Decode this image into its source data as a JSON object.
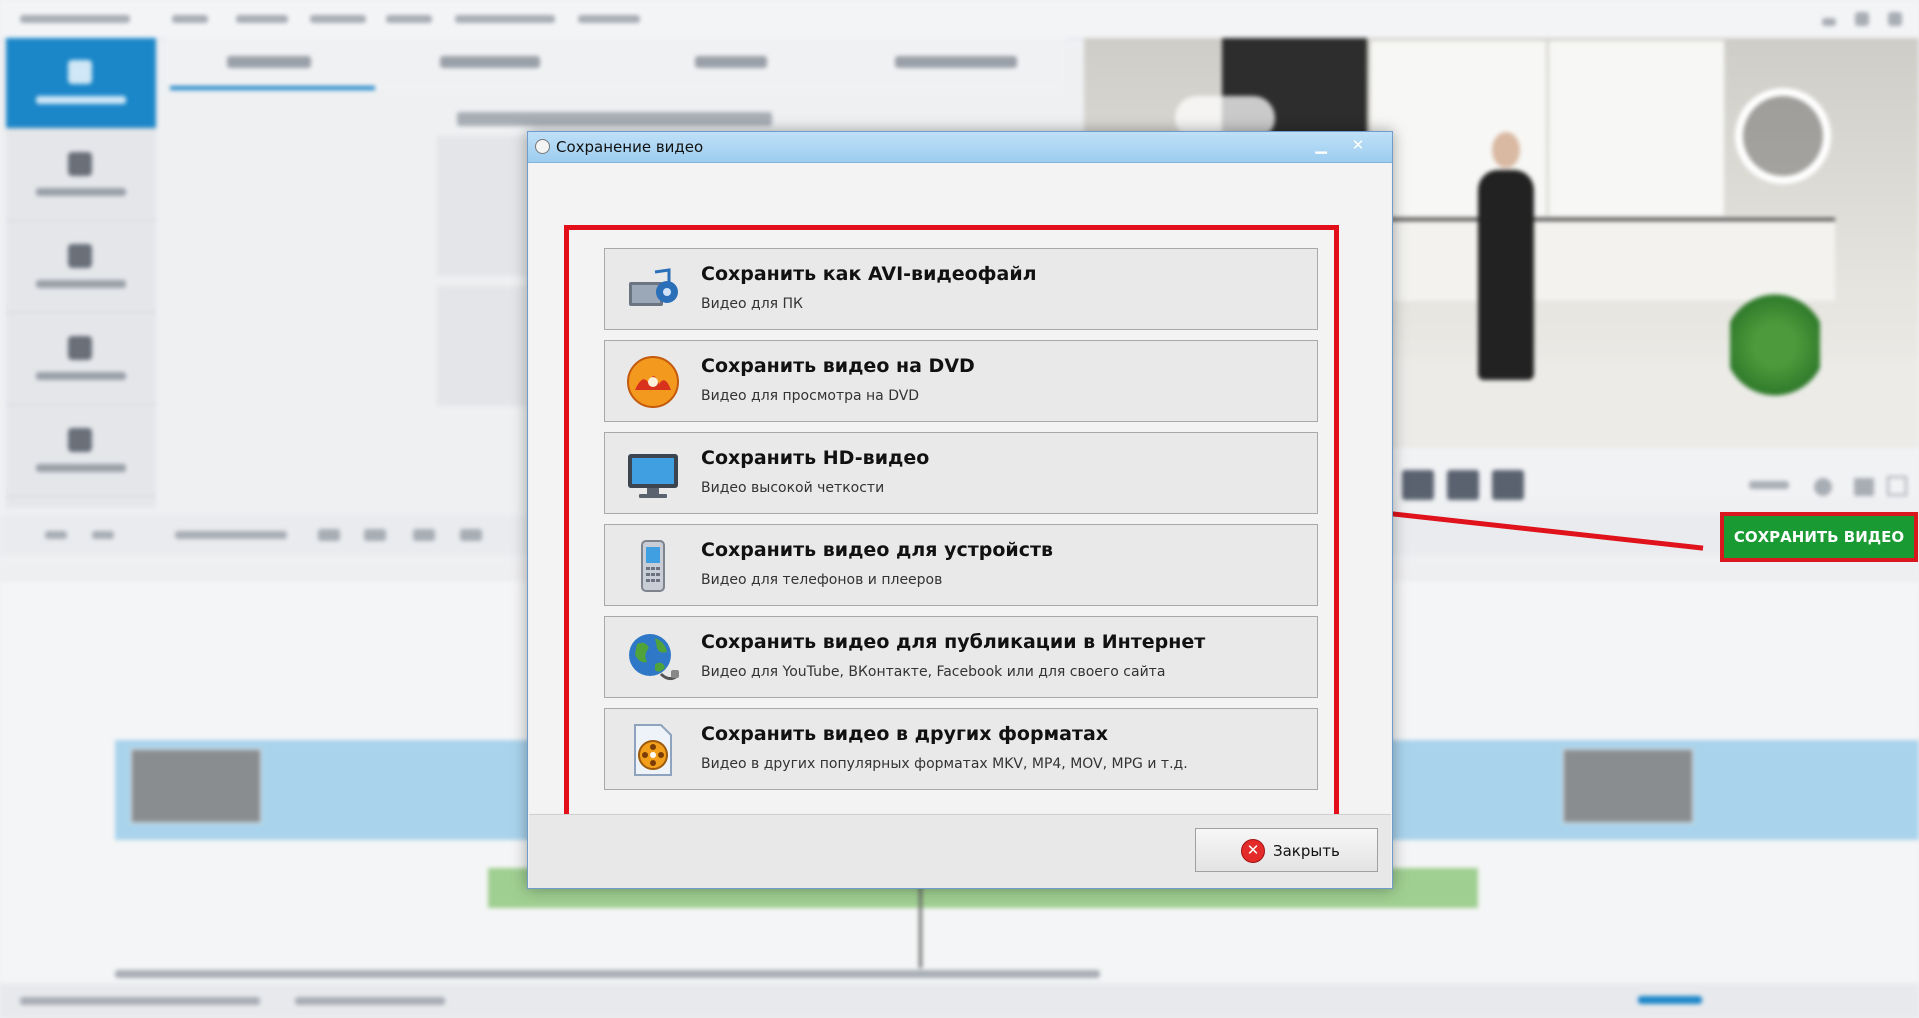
{
  "dialog": {
    "title": "Сохранение видео",
    "minimize_glyph": "▁",
    "close_glyph": "✕",
    "options": [
      {
        "title": "Сохранить как AVI-видеофайл",
        "subtitle": "Видео для ПК",
        "icon": "film-reel-icon"
      },
      {
        "title": "Сохранить видео на DVD",
        "subtitle": "Видео для просмотра на DVD",
        "icon": "dvd-disc-icon"
      },
      {
        "title": "Сохранить HD-видео",
        "subtitle": "Видео высокой четкости",
        "icon": "monitor-icon"
      },
      {
        "title": "Сохранить видео для устройств",
        "subtitle": "Видео для телефонов и плееров",
        "icon": "mobile-phone-icon"
      },
      {
        "title": "Сохранить видео для публикации в Интернет",
        "subtitle": "Видео для YouTube, ВКонтакте, Facebook или для своего сайта",
        "icon": "globe-icon"
      },
      {
        "title": "Сохранить видео в других форматах",
        "subtitle": "Видео в других популярных форматах MKV, MP4, MOV, MPG и т.д.",
        "icon": "film-file-icon"
      }
    ],
    "close_button_label": "Закрыть",
    "close_button_glyph": "✕"
  },
  "save_video_button": "СОХРАНИТЬ ВИДЕО",
  "colors": {
    "highlight_red": "#e20f1b",
    "save_button_green": "#1a9a32",
    "title_bar_blue": "#a9d5f3",
    "sidebar_active": "#1b86c8"
  }
}
